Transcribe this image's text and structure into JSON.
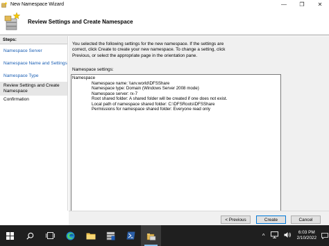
{
  "window": {
    "title": "New Namespace Wizard",
    "heading": "Review Settings and Create Namespace",
    "minimize_glyph": "—",
    "restore_glyph": "❐",
    "close_glyph": "✕"
  },
  "steps": {
    "label": "Steps:",
    "items": [
      "Namespace Server",
      "Namespace Name and Settings",
      "Namespace Type",
      "Review Settings and Create Namespace",
      "Confirmation"
    ]
  },
  "main": {
    "intro": "You selected the following settings for the new namespace. If the settings are correct, click Create to create your new namespace. To change a setting, click Previous, or select the appropriate page in the orientation pane.",
    "settings_label": "Namespace settings:",
    "settings_root": "Namespace",
    "settings_lines": [
      "Namespace name:  \\\\arv.world\\DFSShare",
      "Namespace type:  Domain (Windows Server 2008 mode)",
      "Namespace server: rx-7",
      "Root shared folder:  A shared folder will be created if one does not exist.",
      "Local path of namespace shared folder: C:\\DFSRoots\\DFSShare",
      "Permissions for namespace shared folder: Everyone read only"
    ]
  },
  "buttons": {
    "previous": "< Previous",
    "create": "Create",
    "cancel": "Cancel"
  },
  "taskbar": {
    "time": "6:03 PM",
    "date": "2/10/2022",
    "caret": "^"
  },
  "colors": {
    "link": "#1a5fb4",
    "taskbar": "#1f1f1f",
    "accent": "#0078d7"
  }
}
